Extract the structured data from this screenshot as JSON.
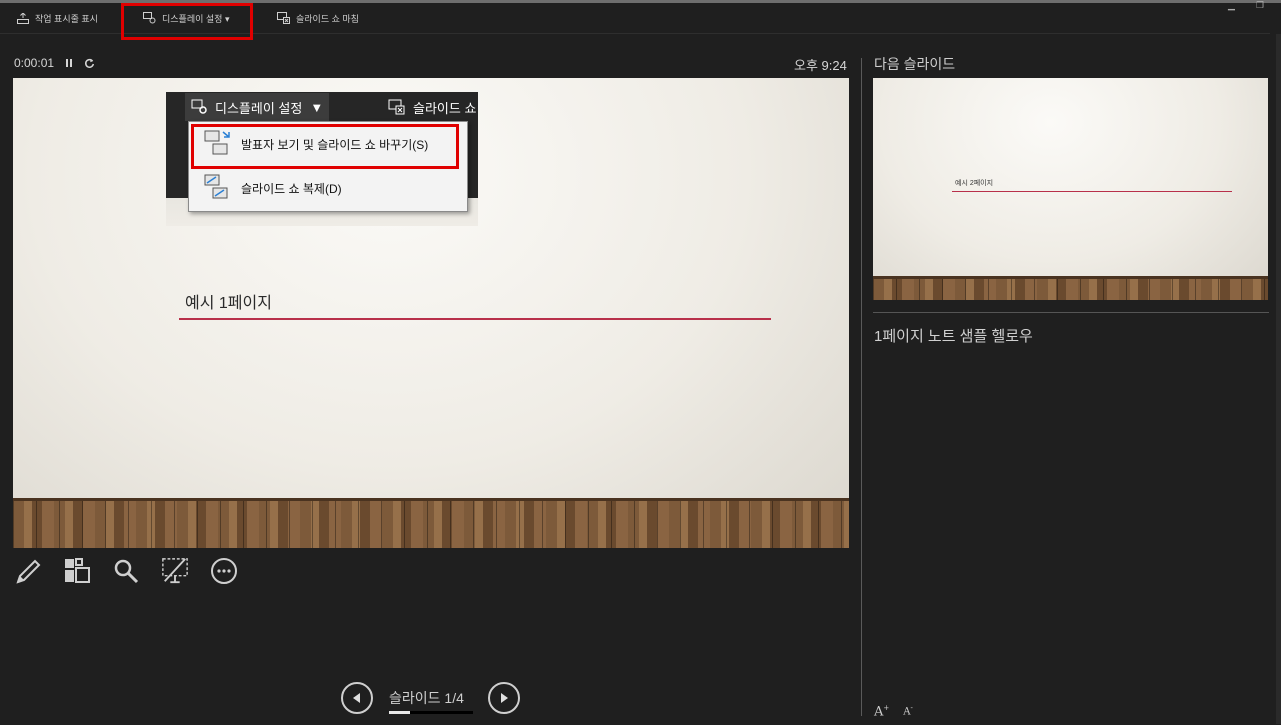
{
  "toolbar": {
    "taskbar_label": "작업 표시줄 표시",
    "display_settings_label": "디스플레이 설정 ▾",
    "end_show_label": "슬라이드 쇼 마침"
  },
  "timer": {
    "elapsed": "0:00:01"
  },
  "clock": "오후 9:24",
  "current_slide": {
    "title": "예시 1페이지",
    "menu_strip": {
      "display_settings_label": "디스플레이 설정",
      "end_show_label": "슬라이드 쇼"
    },
    "dropdown": {
      "items": [
        {
          "label": "발표자 보기 및 슬라이드 쇼 바꾸기(S)"
        },
        {
          "label": "슬라이드 쇼 복제(D)"
        }
      ]
    }
  },
  "navigation": {
    "slide_counter": "슬라이드 1/4",
    "progress": 0.25
  },
  "next_slide": {
    "label": "다음 슬라이드",
    "thumbnail_title": "예시 2페이지"
  },
  "notes": {
    "text": "1페이지 노트 샘플 헬로우"
  },
  "font_controls": {
    "increase": "A",
    "decrease": "A"
  },
  "colors": {
    "highlight": "#e00000",
    "title_underline": "#b8304a",
    "background": "#1f1f1f"
  },
  "icons": [
    "taskbar-icon",
    "display-settings-icon",
    "end-show-icon",
    "pause-icon",
    "restart-icon",
    "pen-icon",
    "see-all-slides-icon",
    "zoom-icon",
    "black-screen-icon",
    "more-options-icon",
    "prev-arrow-icon",
    "next-arrow-icon"
  ]
}
